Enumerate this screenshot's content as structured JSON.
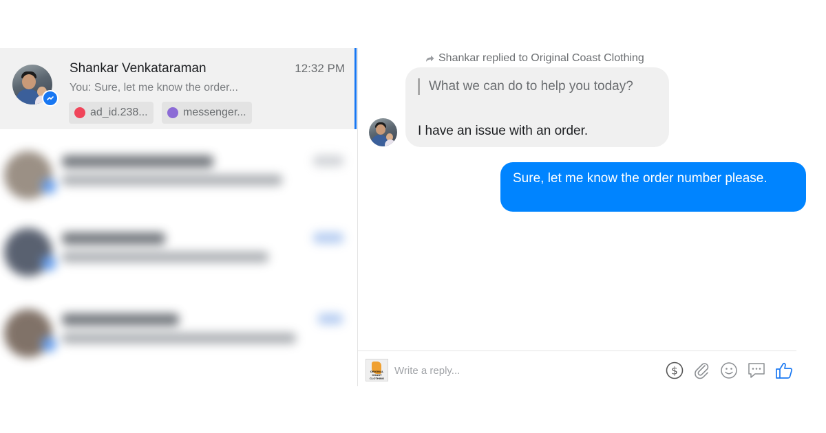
{
  "conversation_list": {
    "active": {
      "name": "Shankar Venkataraman",
      "time": "12:32 PM",
      "snippet": "You: Sure, let me know the order...",
      "tags": [
        {
          "label": "ad_id.238...",
          "color": "#f0455a"
        },
        {
          "label": "messenger...",
          "color": "#8c6bd6"
        }
      ]
    },
    "blurred_rows": 3
  },
  "thread": {
    "reply_note": "Shankar replied to Original Coast Clothing",
    "incoming": {
      "quoted": "What we can do to help you today?",
      "text": "I have an issue with an order."
    },
    "outgoing": {
      "text": "Sure, let me know the order number please."
    }
  },
  "composer": {
    "placeholder": "Write a reply...",
    "page_logo_text": "ORIGINAL COAST CLOTHING",
    "tools": [
      "payment-icon",
      "attachment-icon",
      "emoji-icon",
      "quick-reply-icon",
      "like-icon"
    ]
  },
  "colors": {
    "accent": "#1877f2",
    "outgoing_bubble": "#0084ff",
    "incoming_bubble": "#f0f0f0",
    "active_row": "#f1f1f1"
  }
}
